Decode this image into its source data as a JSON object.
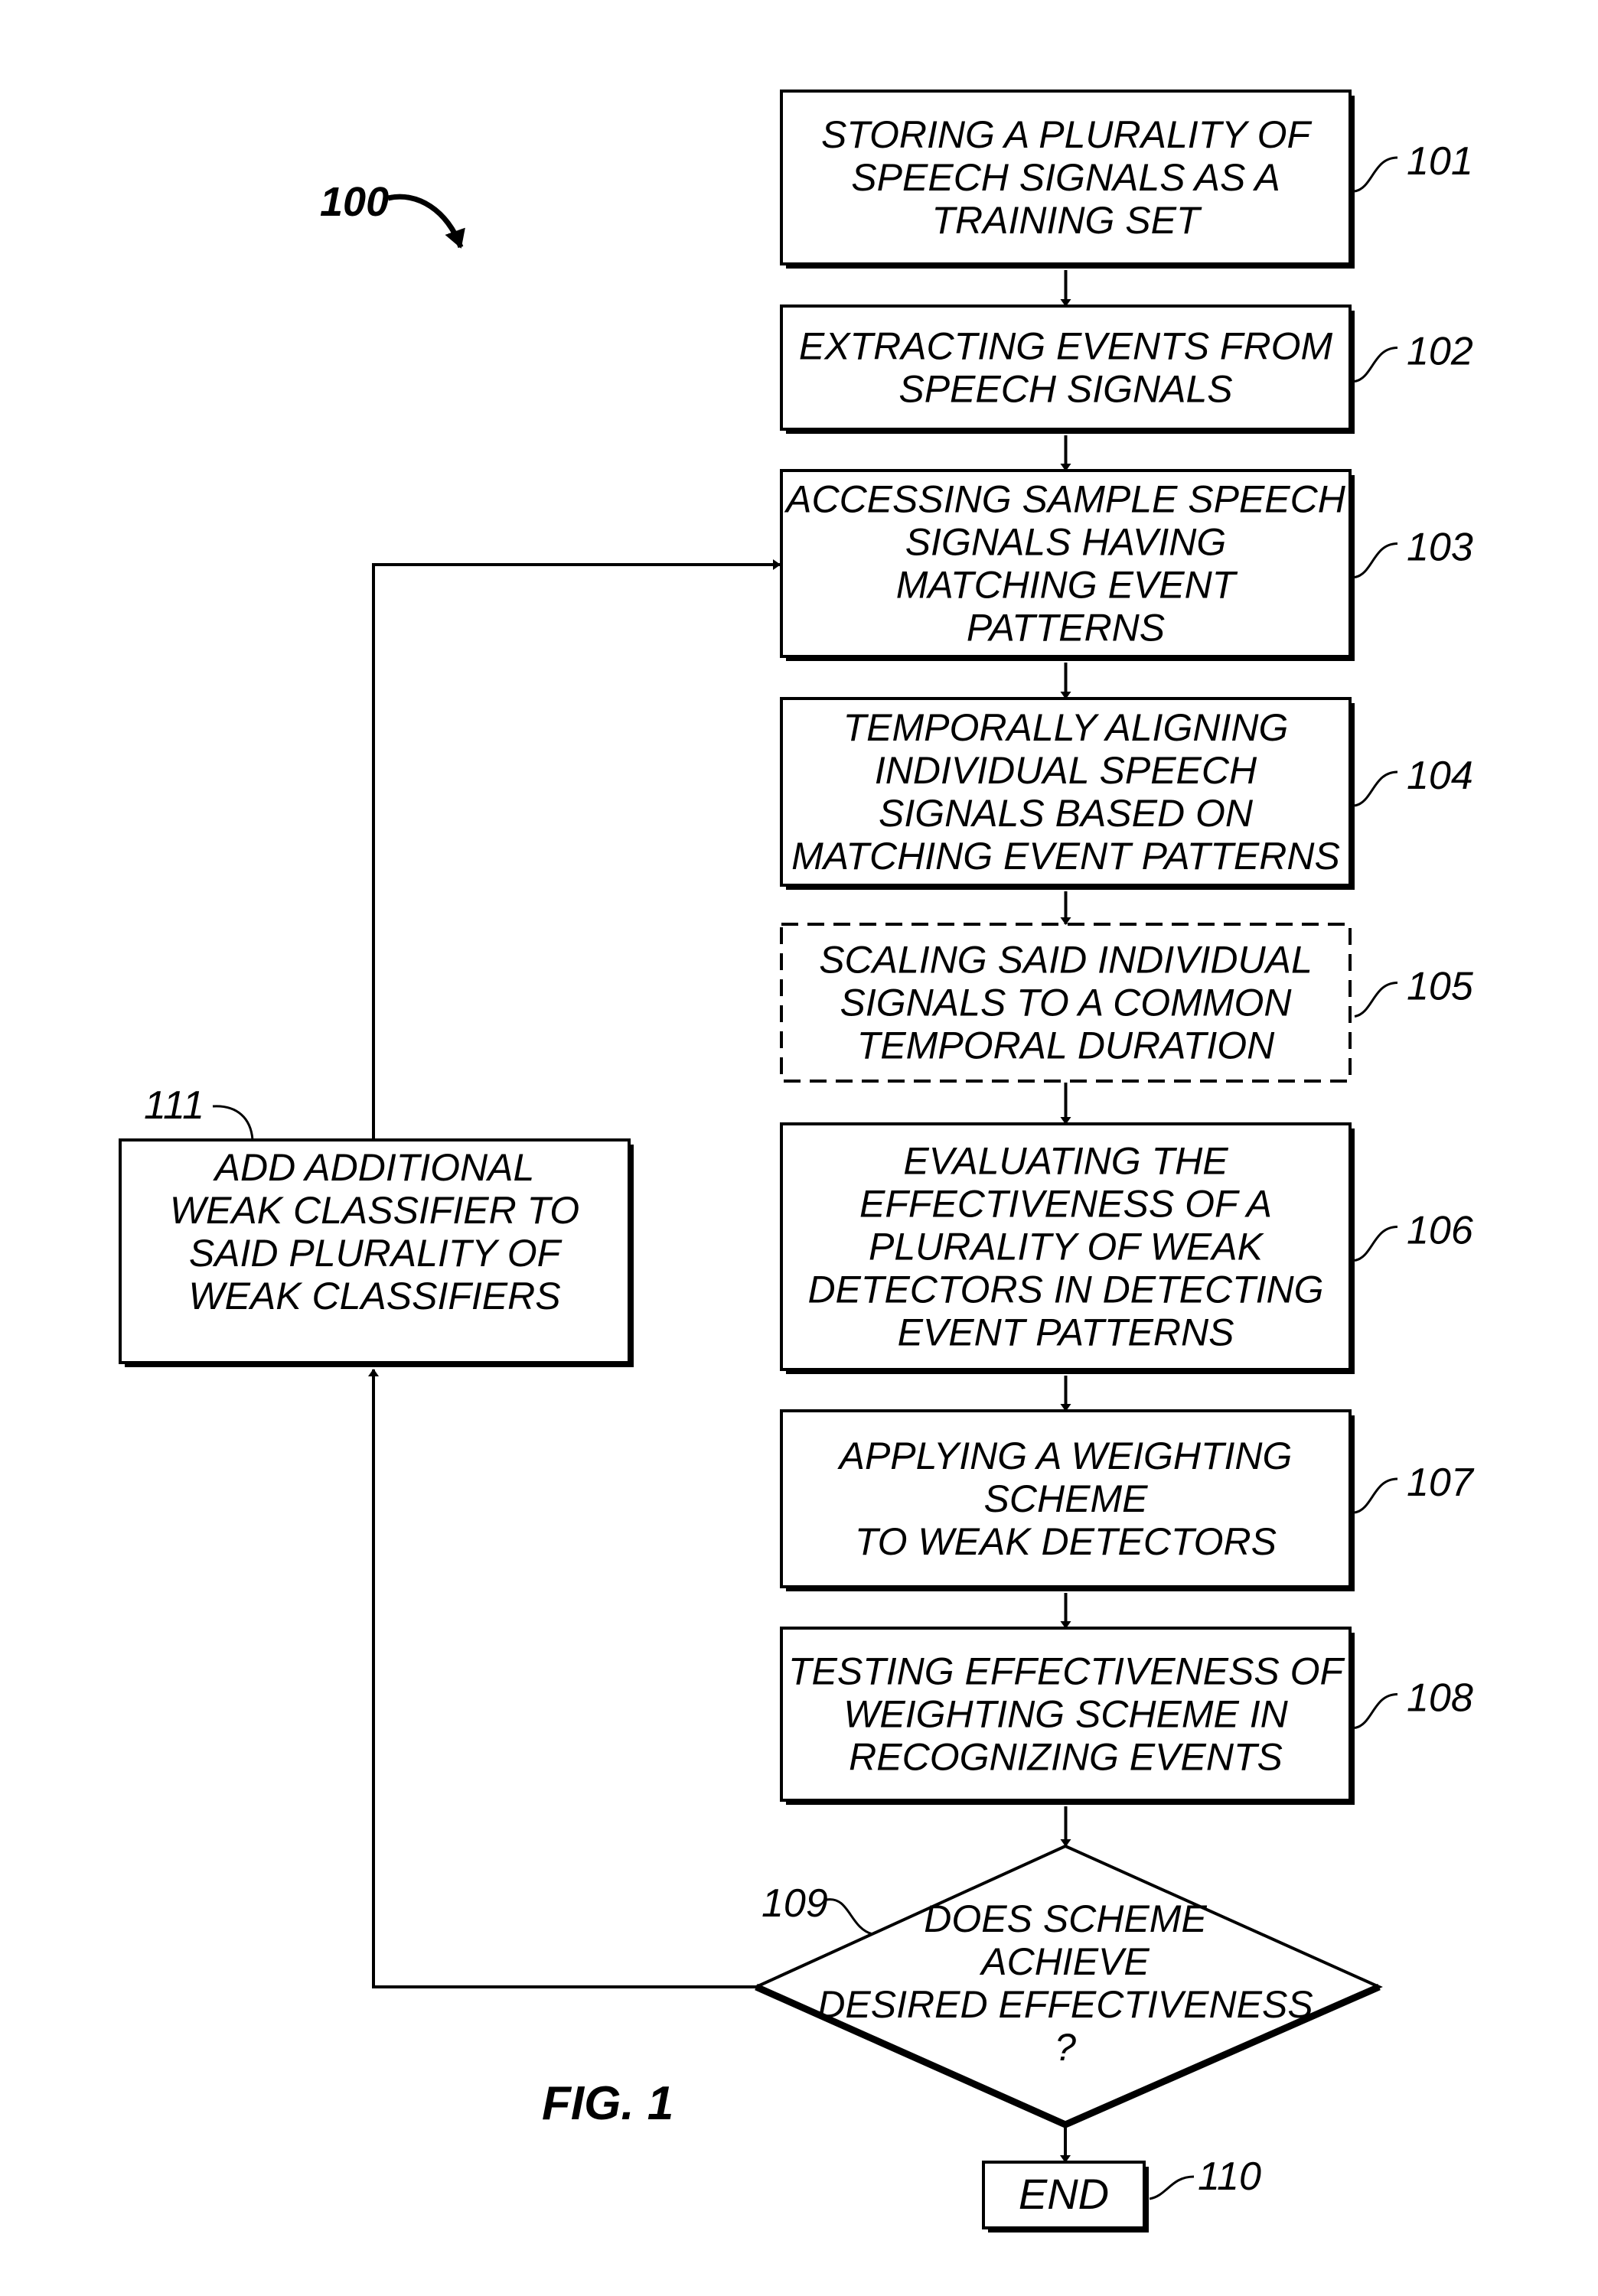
{
  "figure": {
    "ref_label": "100",
    "caption": "FIG. 1"
  },
  "steps": [
    {
      "ref": "101",
      "type": "process",
      "lines": [
        "STORING A PLURALITY OF",
        "SPEECH SIGNALS AS A",
        "TRAINING SET"
      ]
    },
    {
      "ref": "102",
      "type": "process",
      "lines": [
        "EXTRACTING EVENTS FROM",
        "SPEECH SIGNALS"
      ]
    },
    {
      "ref": "103",
      "type": "process",
      "lines": [
        "ACCESSING SAMPLE SPEECH",
        "SIGNALS HAVING",
        "MATCHING EVENT",
        "PATTERNS"
      ]
    },
    {
      "ref": "104",
      "type": "process",
      "lines": [
        "TEMPORALLY ALIGNING",
        "INDIVIDUAL SPEECH",
        "SIGNALS BASED ON",
        "MATCHING EVENT PATTERNS"
      ]
    },
    {
      "ref": "105",
      "type": "optional",
      "lines": [
        "SCALING SAID INDIVIDUAL",
        "SIGNALS TO A COMMON",
        "TEMPORAL DURATION"
      ]
    },
    {
      "ref": "106",
      "type": "process",
      "lines": [
        "EVALUATING THE",
        "EFFECTIVENESS OF A",
        "PLURALITY OF WEAK",
        "DETECTORS IN DETECTING",
        "EVENT PATTERNS"
      ]
    },
    {
      "ref": "107",
      "type": "process",
      "lines": [
        "APPLYING A WEIGHTING",
        "SCHEME",
        "TO WEAK DETECTORS"
      ]
    },
    {
      "ref": "108",
      "type": "process",
      "lines": [
        "TESTING EFFECTIVENESS OF",
        "WEIGHTING SCHEME IN",
        "RECOGNIZING EVENTS"
      ]
    }
  ],
  "decision": {
    "ref": "109",
    "lines": [
      "DOES SCHEME",
      "ACHIEVE",
      "DESIRED EFFECTIVENESS",
      "?"
    ]
  },
  "end": {
    "ref": "110",
    "label": "END"
  },
  "loop_step": {
    "ref": "111",
    "lines": [
      "ADD ADDITIONAL",
      "WEAK CLASSIFIER TO",
      "SAID PLURALITY OF",
      "WEAK CLASSIFIERS"
    ]
  }
}
